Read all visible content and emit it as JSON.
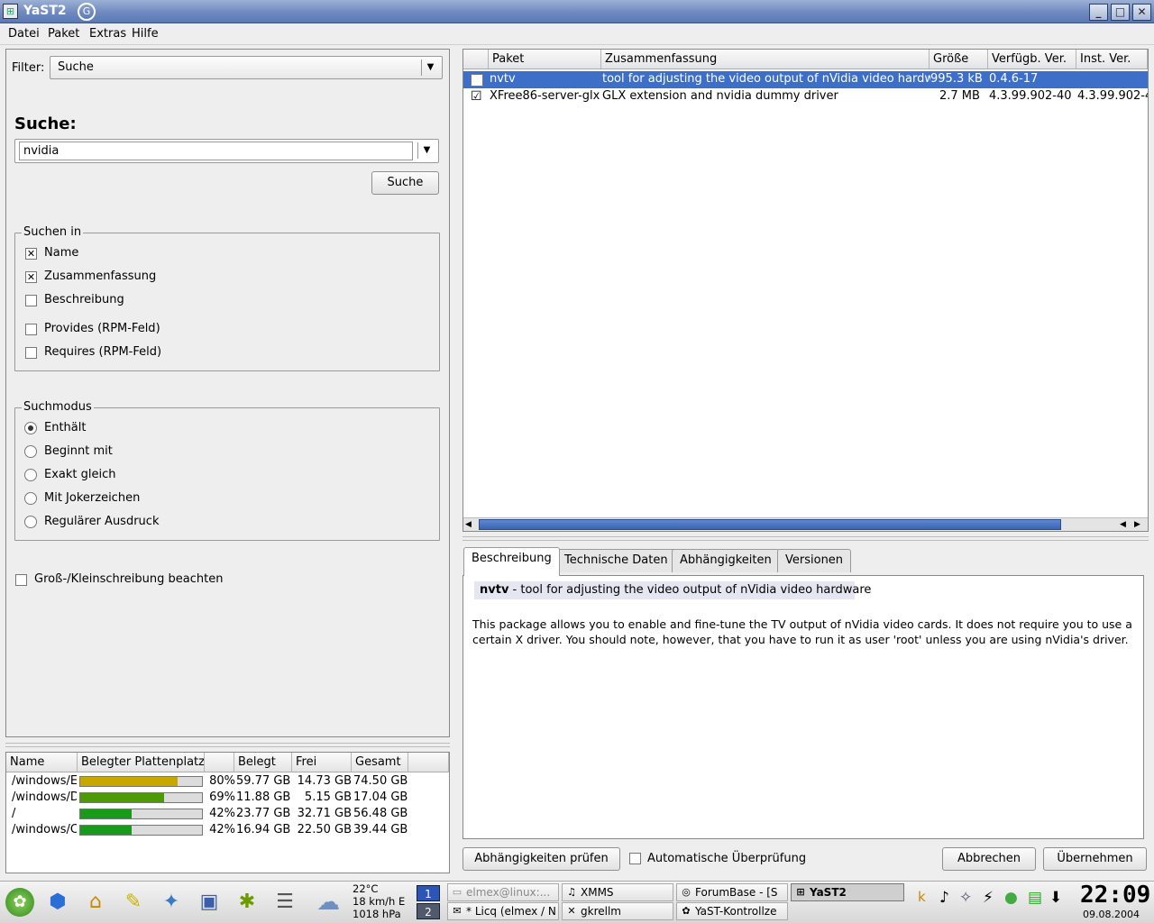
{
  "window": {
    "title": "YaST2"
  },
  "menu": [
    "Datei",
    "Paket",
    "Extras",
    "Hilfe"
  ],
  "filter": {
    "label": "Filter:",
    "value": "Suche"
  },
  "search": {
    "heading": "Suche:",
    "query": "nvidia",
    "button": "Suche",
    "in_title": "Suchen in",
    "in_options": [
      {
        "label": "Name",
        "checked": true
      },
      {
        "label": "Zusammenfassung",
        "checked": true
      },
      {
        "label": "Beschreibung",
        "checked": false
      },
      {
        "label": "Provides (RPM-Feld)",
        "checked": false
      },
      {
        "label": "Requires (RPM-Feld)",
        "checked": false
      }
    ],
    "mode_title": "Suchmodus",
    "modes": [
      {
        "label": "Enthält",
        "selected": true
      },
      {
        "label": "Beginnt mit",
        "selected": false
      },
      {
        "label": "Exakt gleich",
        "selected": false
      },
      {
        "label": "Mit Jokerzeichen",
        "selected": false
      },
      {
        "label": "Regulärer Ausdruck",
        "selected": false
      }
    ],
    "case_label": "Groß-/Kleinschreibung beachten"
  },
  "disk": {
    "headers": [
      "Name",
      "Belegter Plattenplatz",
      "",
      "Belegt",
      "Frei",
      "Gesamt"
    ],
    "rows": [
      {
        "name": "/windows/E",
        "percent": 80,
        "pct_label": "80%",
        "used": "59.77 GB",
        "free": "14.73 GB",
        "total": "74.50 GB",
        "color": "#c8a800"
      },
      {
        "name": "/windows/D",
        "percent": 69,
        "pct_label": "69%",
        "used": "11.88 GB",
        "free": "5.15 GB",
        "total": "17.04 GB",
        "color": "#4e9a06"
      },
      {
        "name": "/",
        "percent": 42,
        "pct_label": "42%",
        "used": "23.77 GB",
        "free": "32.71 GB",
        "total": "56.48 GB",
        "color": "#1a9a1a"
      },
      {
        "name": "/windows/C",
        "percent": 42,
        "pct_label": "42%",
        "used": "16.94 GB",
        "free": "22.50 GB",
        "total": "39.44 GB",
        "color": "#1a9a1a"
      }
    ]
  },
  "packages": {
    "headers": [
      "",
      "Paket",
      "Zusammenfassung",
      "Größe",
      "Verfügb. Ver.",
      "Inst. Ver."
    ],
    "rows": [
      {
        "name": "nvtv",
        "summary": "tool for adjusting the video output of nVidia video hardware",
        "size": "995.3 kB",
        "avail": "0.4.6-17",
        "inst": "",
        "checked": false,
        "selected": true
      },
      {
        "name": "XFree86-server-glx",
        "summary": "GLX extension and nvidia dummy driver",
        "size": "2.7 MB",
        "avail": "4.3.99.902-40",
        "inst": "4.3.99.902-4",
        "checked": true,
        "selected": false
      }
    ]
  },
  "tabs": [
    "Beschreibung",
    "Technische Daten",
    "Abhängigkeiten",
    "Versionen"
  ],
  "detail": {
    "pkg_name": "nvtv",
    "pkg_summary": " - tool for adjusting the video output of nVidia video hardware",
    "desc_line1": "This package allows you to enable and fine-tune the TV output of nVidia video cards. It does not require you to use a",
    "desc_line2": "certain X driver. You should note, however, that you have to run it as user 'root' unless you are using nVidia's driver."
  },
  "bottom": {
    "deps_button": "Abhängigkeiten prüfen",
    "auto_check": "Automatische Überprüfung",
    "cancel": "Abbrechen",
    "accept": "Übernehmen"
  },
  "taskbar": {
    "weather": {
      "temp": "22°C",
      "wind": "18 km/h E",
      "pressure": "1018 hPa"
    },
    "desktops": [
      "1",
      "2"
    ],
    "tasks_row1": [
      "elmex@linux:...",
      "XMMS",
      "ForumBase - [S",
      "YaST2"
    ],
    "tasks_row2": [
      "* Licq (elmex / N",
      "gkrellm",
      "YaST-Kontrollze"
    ],
    "clock": "22:09",
    "date": "09.08.2004"
  }
}
